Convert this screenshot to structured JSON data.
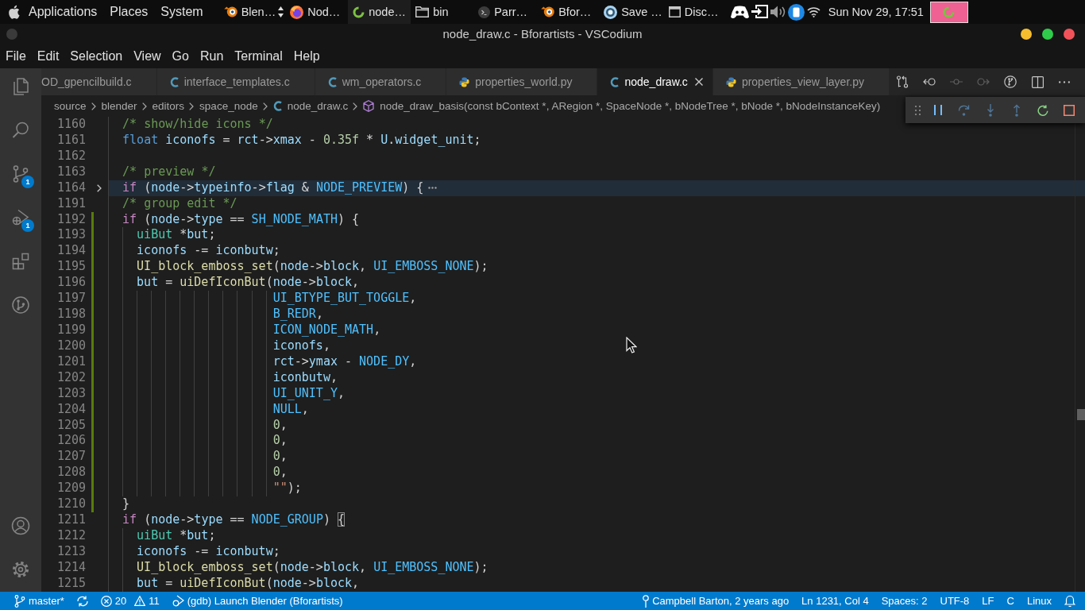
{
  "top_panel": {
    "menus": [
      "Applications",
      "Places",
      "System"
    ],
    "tasks": [
      {
        "label": "Blen…",
        "kind": "ring",
        "grouped": true,
        "selected": false
      },
      {
        "label": "Nod…",
        "kind": "globe",
        "grouped": false,
        "selected": false
      },
      {
        "label": "node…",
        "kind": "loop",
        "grouped": false,
        "selected": true
      },
      {
        "label": "bin",
        "kind": "folder",
        "grouped": false,
        "selected": false
      },
      {
        "label": "Parr…",
        "kind": "terminal",
        "grouped": false,
        "selected": false
      },
      {
        "label": "Bfor…",
        "kind": "ring",
        "grouped": false,
        "selected": false
      },
      {
        "label": "Save …",
        "kind": "target",
        "grouped": false,
        "selected": false
      },
      {
        "label": "Disc…",
        "kind": "window",
        "grouped": false,
        "selected": false
      }
    ],
    "clock": "Sun Nov 29, 17:51"
  },
  "window": {
    "title": "node_draw.c - Bforartists - VSCodium"
  },
  "menu": [
    "File",
    "Edit",
    "Selection",
    "View",
    "Go",
    "Run",
    "Terminal",
    "Help"
  ],
  "activity_bar": {
    "items": [
      {
        "kind": "files",
        "selected": false
      },
      {
        "kind": "search",
        "selected": false
      },
      {
        "kind": "source_control",
        "selected": false,
        "badge": "1"
      },
      {
        "kind": "debug",
        "selected": false,
        "badge": "1"
      },
      {
        "kind": "extensions",
        "selected": false
      },
      {
        "kind": "git_graph",
        "selected": false
      }
    ],
    "bottom": [
      {
        "kind": "account"
      },
      {
        "kind": "settings"
      }
    ]
  },
  "tabs": [
    {
      "label": "OD_gpencilbuild.c",
      "selected": false
    },
    {
      "label": "interface_templates.c",
      "kind": "c",
      "selected": false
    },
    {
      "label": "wm_operators.c",
      "kind": "c",
      "selected": false
    },
    {
      "label": "properties_world.py",
      "kind": "python",
      "selected": false
    },
    {
      "label": "node_draw.c",
      "kind": "c",
      "selected": true
    },
    {
      "label": "properties_view_layer.py",
      "kind": "python",
      "selected": false
    }
  ],
  "editor_actions": [
    {
      "kind": "compare",
      "disabled": false
    },
    {
      "kind": "back",
      "disabled": false
    },
    {
      "kind": "current",
      "disabled": true
    },
    {
      "kind": "forward",
      "disabled": true
    },
    {
      "kind": "graph",
      "disabled": false
    },
    {
      "kind": "split",
      "disabled": false
    },
    {
      "kind": "more",
      "disabled": false
    }
  ],
  "breadcrumbs": [
    {
      "kind": "folder",
      "label": "source"
    },
    {
      "kind": "folder",
      "label": "blender"
    },
    {
      "kind": "folder",
      "label": "editors"
    },
    {
      "kind": "folder",
      "label": "space_node"
    },
    {
      "kind": "file",
      "label": "node_draw.c"
    },
    {
      "kind": "symbol",
      "label": "node_draw_basis(const bContext *, ARegion *, SpaceNode *, bNodeTree *, bNode *, bNodeInstanceKey)"
    }
  ],
  "debug_toolbar": [
    {
      "kind": "pause",
      "disabled": false
    },
    {
      "kind": "step_over",
      "disabled": true
    },
    {
      "kind": "step_into",
      "disabled": true
    },
    {
      "kind": "step_out",
      "disabled": true
    },
    {
      "kind": "restart",
      "disabled": false
    },
    {
      "kind": "stop",
      "disabled": false
    }
  ],
  "editor": {
    "lines": [
      {
        "number": "1160",
        "folded": false,
        "added": false,
        "tokens": [
          {
            "kind": "comment",
            "text": "/* show/hide icons */"
          }
        ]
      },
      {
        "number": "1161",
        "folded": false,
        "added": false,
        "tokens": [
          {
            "kind": "storage",
            "text": "float"
          },
          {
            "kind": "variable",
            "text": " iconofs"
          },
          {
            "kind": "plain",
            "text": " = "
          },
          {
            "kind": "variable",
            "text": "rct"
          },
          {
            "kind": "plain",
            "text": "->"
          },
          {
            "kind": "variable",
            "text": "xmax"
          },
          {
            "kind": "plain",
            "text": " - "
          },
          {
            "kind": "number",
            "text": "0.35f"
          },
          {
            "kind": "plain",
            "text": " * "
          },
          {
            "kind": "variable",
            "text": "U"
          },
          {
            "kind": "plain",
            "text": "."
          },
          {
            "kind": "variable",
            "text": "widget_unit"
          },
          {
            "kind": "plain",
            "text": ";"
          }
        ]
      },
      {
        "number": "1162",
        "folded": false,
        "added": false
      },
      {
        "number": "1163",
        "folded": false,
        "added": false,
        "tokens": [
          {
            "kind": "comment",
            "text": "/* preview */"
          }
        ]
      },
      {
        "number": "1164",
        "folded": true,
        "added": false,
        "tokens": [
          {
            "kind": "keyword",
            "text": "if"
          },
          {
            "kind": "plain",
            "text": " ("
          },
          {
            "kind": "variable",
            "text": "node"
          },
          {
            "kind": "plain",
            "text": "->"
          },
          {
            "kind": "variable",
            "text": "typeinfo"
          },
          {
            "kind": "plain",
            "text": "->"
          },
          {
            "kind": "variable",
            "text": "flag"
          },
          {
            "kind": "plain",
            "text": " & "
          },
          {
            "kind": "macro",
            "text": "NODE_PREVIEW"
          },
          {
            "kind": "plain",
            "text": ") {"
          }
        ]
      },
      {
        "number": "1191",
        "folded": false,
        "added": false,
        "tokens": [
          {
            "kind": "comment",
            "text": "/* group edit */"
          }
        ]
      },
      {
        "number": "1192",
        "folded": false,
        "added": true,
        "tokens": [
          {
            "kind": "keyword",
            "text": "if"
          },
          {
            "kind": "plain",
            "text": " ("
          },
          {
            "kind": "variable",
            "text": "node"
          },
          {
            "kind": "plain",
            "text": "->"
          },
          {
            "kind": "variable",
            "text": "type"
          },
          {
            "kind": "plain",
            "text": " == "
          },
          {
            "kind": "macro",
            "text": "SH_NODE_MATH"
          },
          {
            "kind": "plain",
            "text": ") {"
          }
        ]
      },
      {
        "number": "1193",
        "folded": false,
        "added": true,
        "tokens": [
          {
            "kind": "type",
            "text": "  uiBut"
          },
          {
            "kind": "plain",
            "text": " *"
          },
          {
            "kind": "variable",
            "text": "but"
          },
          {
            "kind": "plain",
            "text": ";"
          }
        ]
      },
      {
        "number": "1194",
        "folded": false,
        "added": true,
        "tokens": [
          {
            "kind": "variable",
            "text": "  iconofs"
          },
          {
            "kind": "plain",
            "text": " -= "
          },
          {
            "kind": "variable",
            "text": "iconbutw"
          },
          {
            "kind": "plain",
            "text": ";"
          }
        ]
      },
      {
        "number": "1195",
        "folded": false,
        "added": true,
        "tokens": [
          {
            "kind": "function",
            "text": "  UI_block_emboss_set"
          },
          {
            "kind": "plain",
            "text": "("
          },
          {
            "kind": "variable",
            "text": "node"
          },
          {
            "kind": "plain",
            "text": "->"
          },
          {
            "kind": "variable",
            "text": "block"
          },
          {
            "kind": "plain",
            "text": ", "
          },
          {
            "kind": "macro",
            "text": "UI_EMBOSS_NONE"
          },
          {
            "kind": "plain",
            "text": ");"
          }
        ]
      },
      {
        "number": "1196",
        "folded": false,
        "added": true,
        "tokens": [
          {
            "kind": "variable",
            "text": "  but"
          },
          {
            "kind": "plain",
            "text": " = "
          },
          {
            "kind": "function",
            "text": "uiDefIconBut"
          },
          {
            "kind": "plain",
            "text": "("
          },
          {
            "kind": "variable",
            "text": "node"
          },
          {
            "kind": "plain",
            "text": "->"
          },
          {
            "kind": "variable",
            "text": "block"
          },
          {
            "kind": "plain",
            "text": ","
          }
        ]
      },
      {
        "number": "1197",
        "folded": false,
        "added": true,
        "tokens": [
          {
            "kind": "macro",
            "text": "                     UI_BTYPE_BUT_TOGGLE"
          },
          {
            "kind": "plain",
            "text": ","
          }
        ]
      },
      {
        "number": "1198",
        "folded": false,
        "added": true,
        "tokens": [
          {
            "kind": "macro",
            "text": "                     B_REDR"
          },
          {
            "kind": "plain",
            "text": ","
          }
        ]
      },
      {
        "number": "1199",
        "folded": false,
        "added": true,
        "tokens": [
          {
            "kind": "macro",
            "text": "                     ICON_NODE_MATH"
          },
          {
            "kind": "plain",
            "text": ","
          }
        ]
      },
      {
        "number": "1200",
        "folded": false,
        "added": true,
        "tokens": [
          {
            "kind": "variable",
            "text": "                     iconofs"
          },
          {
            "kind": "plain",
            "text": ","
          }
        ]
      },
      {
        "number": "1201",
        "folded": false,
        "added": true,
        "tokens": [
          {
            "kind": "variable",
            "text": "                     rct"
          },
          {
            "kind": "plain",
            "text": "->"
          },
          {
            "kind": "variable",
            "text": "ymax"
          },
          {
            "kind": "plain",
            "text": " - "
          },
          {
            "kind": "macro",
            "text": "NODE_DY"
          },
          {
            "kind": "plain",
            "text": ","
          }
        ]
      },
      {
        "number": "1202",
        "folded": false,
        "added": true,
        "tokens": [
          {
            "kind": "variable",
            "text": "                     iconbutw"
          },
          {
            "kind": "plain",
            "text": ","
          }
        ]
      },
      {
        "number": "1203",
        "folded": false,
        "added": true,
        "tokens": [
          {
            "kind": "macro",
            "text": "                     UI_UNIT_Y"
          },
          {
            "kind": "plain",
            "text": ","
          }
        ]
      },
      {
        "number": "1204",
        "folded": false,
        "added": true,
        "tokens": [
          {
            "kind": "macro",
            "text": "                     NULL"
          },
          {
            "kind": "plain",
            "text": ","
          }
        ]
      },
      {
        "number": "1205",
        "folded": false,
        "added": true,
        "tokens": [
          {
            "kind": "number",
            "text": "                     0"
          },
          {
            "kind": "plain",
            "text": ","
          }
        ]
      },
      {
        "number": "1206",
        "folded": false,
        "added": true,
        "tokens": [
          {
            "kind": "number",
            "text": "                     0"
          },
          {
            "kind": "plain",
            "text": ","
          }
        ]
      },
      {
        "number": "1207",
        "folded": false,
        "added": true,
        "tokens": [
          {
            "kind": "number",
            "text": "                     0"
          },
          {
            "kind": "plain",
            "text": ","
          }
        ]
      },
      {
        "number": "1208",
        "folded": false,
        "added": true,
        "tokens": [
          {
            "kind": "number",
            "text": "                     0"
          },
          {
            "kind": "plain",
            "text": ","
          }
        ]
      },
      {
        "number": "1209",
        "folded": false,
        "added": true,
        "tokens": [
          {
            "kind": "string",
            "text": "                     \"\""
          },
          {
            "kind": "plain",
            "text": ");"
          }
        ]
      },
      {
        "number": "1210",
        "folded": false,
        "added": true,
        "tokens": [
          {
            "kind": "plain",
            "text": "}"
          }
        ]
      },
      {
        "number": "1211",
        "folded": false,
        "added": false,
        "tokens": [
          {
            "kind": "keyword",
            "text": "if"
          },
          {
            "kind": "plain",
            "text": " ("
          },
          {
            "kind": "variable",
            "text": "node"
          },
          {
            "kind": "plain",
            "text": "->"
          },
          {
            "kind": "variable",
            "text": "type"
          },
          {
            "kind": "plain",
            "text": " == "
          },
          {
            "kind": "macro",
            "text": "NODE_GROUP"
          },
          {
            "kind": "plain",
            "text": ") "
          },
          {
            "kind": "match",
            "text": "{"
          }
        ]
      },
      {
        "number": "1212",
        "folded": false,
        "added": false,
        "tokens": [
          {
            "kind": "type",
            "text": "  uiBut"
          },
          {
            "kind": "plain",
            "text": " *"
          },
          {
            "kind": "variable",
            "text": "but"
          },
          {
            "kind": "plain",
            "text": ";"
          }
        ]
      },
      {
        "number": "1213",
        "folded": false,
        "added": false,
        "tokens": [
          {
            "kind": "variable",
            "text": "  iconofs"
          },
          {
            "kind": "plain",
            "text": " -= "
          },
          {
            "kind": "variable",
            "text": "iconbutw"
          },
          {
            "kind": "plain",
            "text": ";"
          }
        ]
      },
      {
        "number": "1214",
        "folded": false,
        "added": false,
        "tokens": [
          {
            "kind": "function",
            "text": "  UI_block_emboss_set"
          },
          {
            "kind": "plain",
            "text": "("
          },
          {
            "kind": "variable",
            "text": "node"
          },
          {
            "kind": "plain",
            "text": "->"
          },
          {
            "kind": "variable",
            "text": "block"
          },
          {
            "kind": "plain",
            "text": ", "
          },
          {
            "kind": "macro",
            "text": "UI_EMBOSS_NONE"
          },
          {
            "kind": "plain",
            "text": ");"
          }
        ]
      },
      {
        "number": "1215",
        "folded": false,
        "added": false,
        "tokens": [
          {
            "kind": "variable",
            "text": "  but"
          },
          {
            "kind": "plain",
            "text": " = "
          },
          {
            "kind": "function",
            "text": "uiDefIconBut"
          },
          {
            "kind": "plain",
            "text": "("
          },
          {
            "kind": "variable",
            "text": "node"
          },
          {
            "kind": "plain",
            "text": "->"
          },
          {
            "kind": "variable",
            "text": "block"
          },
          {
            "kind": "plain",
            "text": ","
          }
        ]
      }
    ]
  },
  "status_bar": {
    "left": [
      {
        "kind": "branch",
        "text": "master*"
      },
      {
        "kind": "sync"
      },
      {
        "kind": "problems",
        "errors": "20",
        "warnings": "11"
      },
      {
        "kind": "launch",
        "text": "(gdb) Launch Blender (Bforartists)"
      }
    ],
    "right": [
      {
        "kind": "blame",
        "text": "Campbell Barton, 2 years ago"
      },
      {
        "kind": "plain",
        "text": "Ln 1231, Col 4"
      },
      {
        "kind": "plain",
        "text": "Spaces: 2"
      },
      {
        "kind": "plain",
        "text": "UTF-8"
      },
      {
        "kind": "plain",
        "text": "LF"
      },
      {
        "kind": "plain",
        "text": "C"
      },
      {
        "kind": "plain",
        "text": "Linux"
      },
      {
        "kind": "bell"
      }
    ]
  }
}
